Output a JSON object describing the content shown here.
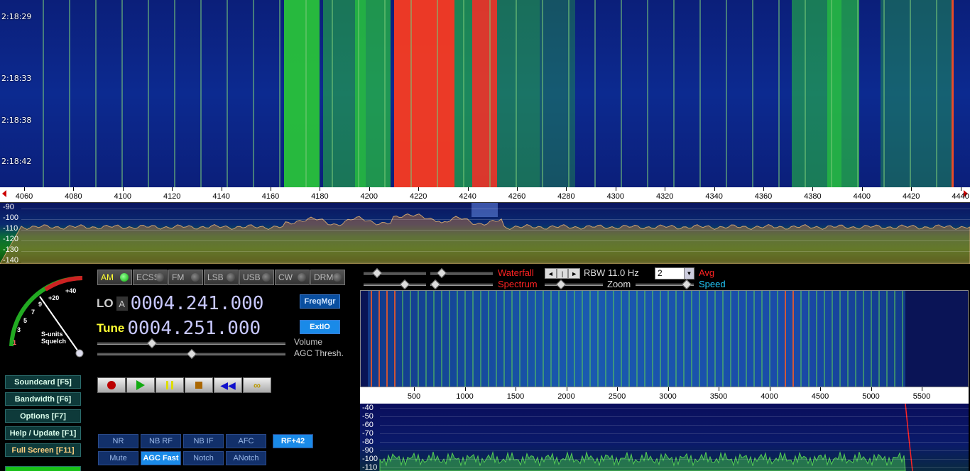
{
  "waterfall": {
    "time_labels": [
      "2:18:29",
      "2:18:33",
      "2:18:38",
      "2:18:42"
    ]
  },
  "freq_scale": {
    "ticks": [
      "4060",
      "4080",
      "4100",
      "4120",
      "4140",
      "4160",
      "4180",
      "4200",
      "4220",
      "4240",
      "4260",
      "4280",
      "4300",
      "4320",
      "4340",
      "4360",
      "4380",
      "4400",
      "4420",
      "4440"
    ]
  },
  "spectrum": {
    "db_labels": [
      "-90",
      "-100",
      "-110",
      "-120",
      "-130",
      "-140"
    ]
  },
  "smeter": {
    "scale": [
      "1",
      "3",
      "5",
      "7",
      "9",
      "+20",
      "+40"
    ],
    "label_line1": "S-units",
    "label_line2": "Squelch"
  },
  "modes": [
    {
      "label": "AM",
      "active": true
    },
    {
      "label": "ECSS",
      "active": false
    },
    {
      "label": "FM",
      "active": false
    },
    {
      "label": "LSB",
      "active": false
    },
    {
      "label": "USB",
      "active": false
    },
    {
      "label": "CW",
      "active": false
    },
    {
      "label": "DRM",
      "active": false
    }
  ],
  "lo": {
    "tag": "LO",
    "sub": "A",
    "freq": "0004.241.000"
  },
  "tune": {
    "tag": "Tune",
    "freq": "0004.251.000"
  },
  "buttons": {
    "freqmgr": "FreqMgr",
    "extio": "ExtIO"
  },
  "sliders": {
    "volume_label": "Volume",
    "agc_label": "AGC Thresh.",
    "volume_level": 0.29,
    "agc_level": 0.5
  },
  "menu": [
    {
      "label": "Soundcard  [F5]",
      "style": "normal"
    },
    {
      "label": "Bandwidth  [F6]",
      "style": "normal"
    },
    {
      "label": "Options   [F7]",
      "style": "normal"
    },
    {
      "label": "Help / Update  [F1]",
      "style": "normal"
    },
    {
      "label": "Full Screen  [F11]",
      "style": "gold"
    }
  ],
  "dsp": [
    {
      "label": "NR",
      "active": false
    },
    {
      "label": "NB RF",
      "active": false
    },
    {
      "label": "NB IF",
      "active": false
    },
    {
      "label": "AFC",
      "active": false
    },
    {
      "label": "RF+42",
      "active": true
    },
    {
      "label": "Mute",
      "active": false
    },
    {
      "label": "AGC Fast",
      "active": true
    },
    {
      "label": "Notch",
      "active": false
    },
    {
      "label": "ANotch",
      "active": false
    }
  ],
  "right_controls": {
    "waterfall_label": "Waterfall",
    "spectrum_label": "Spectrum",
    "rbw_label": "RBW 11.0 Hz",
    "zoom_label": "Zoom",
    "avg_value": "2",
    "avg_label": "Avg",
    "speed_label": "Speed"
  },
  "audio_scale": {
    "ticks": [
      "500",
      "1000",
      "1500",
      "2000",
      "2500",
      "3000",
      "3500",
      "4000",
      "4500",
      "5000",
      "5500"
    ]
  },
  "audio_spectrum": {
    "db_labels": [
      "-40",
      "-50",
      "-60",
      "-70",
      "-80",
      "-90",
      "-100",
      "-110"
    ]
  },
  "colors": {
    "waterfall_bg": "#0c2a90",
    "signal_red": "#ff3a1a",
    "signal_green": "#28c040",
    "accent_blue": "#1a8ae8"
  }
}
